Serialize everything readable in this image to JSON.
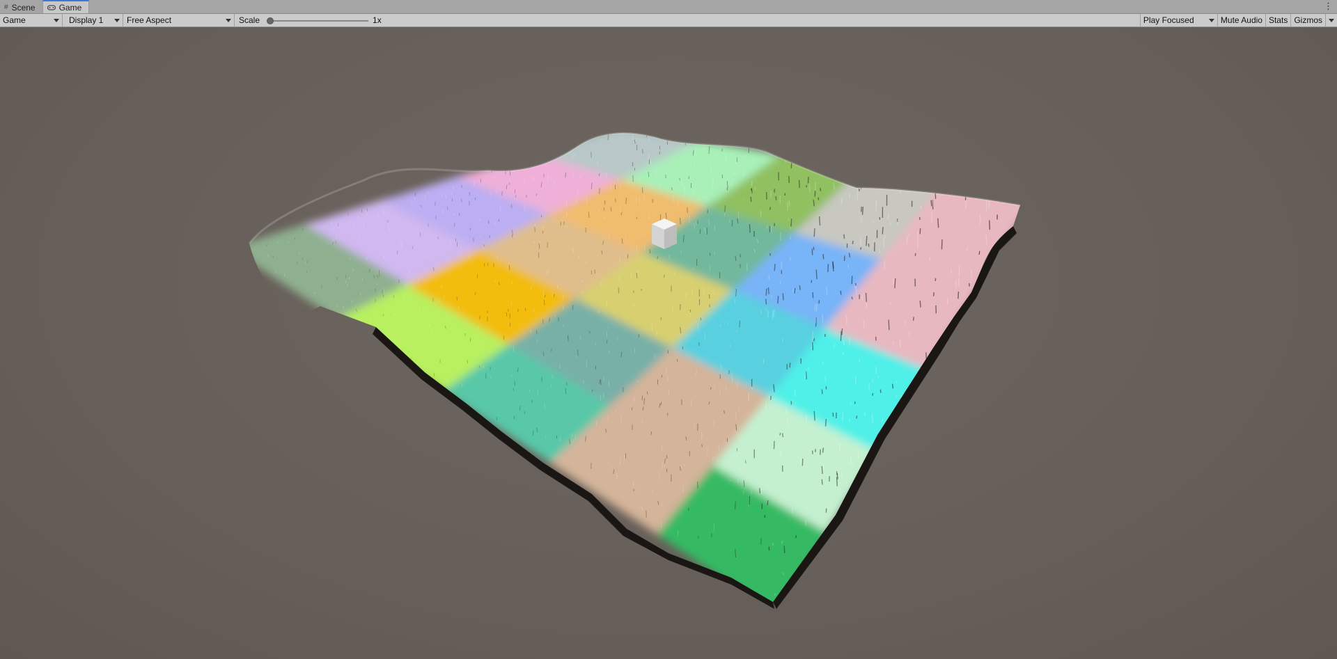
{
  "tabs": [
    {
      "label": "Scene",
      "icon": "scene-grid-icon",
      "active": false
    },
    {
      "label": "Game",
      "icon": "gamepad-icon",
      "active": true
    }
  ],
  "toolbar": {
    "view_select": "Game",
    "display_select": "Display 1",
    "aspect_select": "Free Aspect",
    "scale_label": "Scale",
    "scale_value": "1x",
    "scale_level": 0,
    "play_focused": "Play Focused",
    "mute_audio": "Mute Audio",
    "stats": "Stats",
    "gizmos": "Gizmos"
  },
  "scene": {
    "background_color": "#686058",
    "terrain_tile_colors": [
      [
        "#8fb08f",
        "#d0b8f0",
        "#bcaef2",
        "#eeb0d8",
        "#b8c8c8"
      ],
      [
        "#b8f060",
        "#f3bd0a",
        "#e0be8c",
        "#f0bc6e",
        "#a8f0b8"
      ],
      [
        "#58c8a8",
        "#78b0a8",
        "#d8d070",
        "#72b89c",
        "#90c060"
      ],
      [
        "#d4b49a",
        "#d4b49a",
        "#58d0e0",
        "#78b4f8",
        "#c8c8c0"
      ],
      [
        "#34ba64",
        "#c4f0d0",
        "#50f0e8",
        "#e8b8c0",
        "#e8b8c0"
      ]
    ],
    "object": "white cube"
  }
}
